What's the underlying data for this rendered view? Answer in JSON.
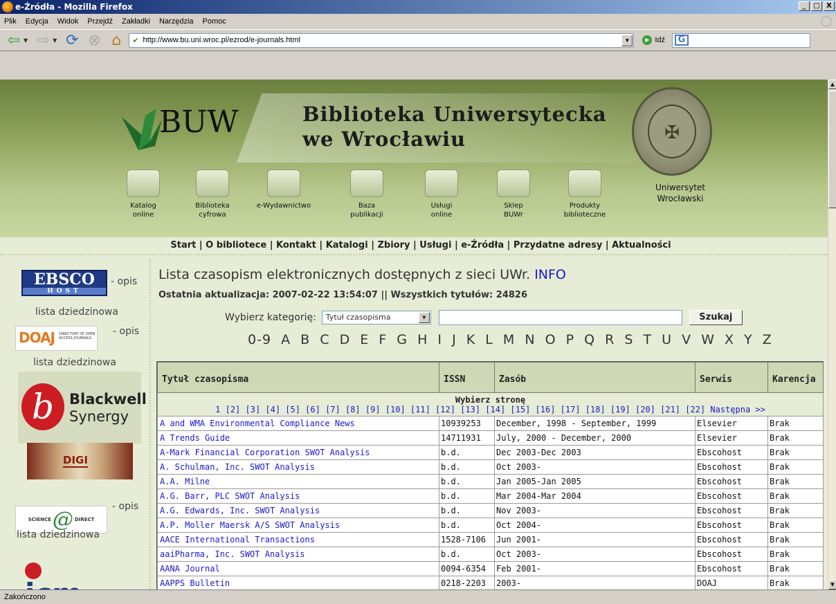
{
  "window": {
    "title": "e-Źródła - Mozilla Firefox",
    "buttons": [
      "_",
      "□",
      "X"
    ]
  },
  "menu": [
    "Plik",
    "Edycja",
    "Widok",
    "Przejdź",
    "Zakładki",
    "Narzędzia",
    "Pomoc"
  ],
  "toolbar": {
    "url": "http://www.bu.uni.wroc.pl/ezrod/e-journals.html",
    "go_label": "Idź",
    "search_engine_icon": "google-icon"
  },
  "banner": {
    "title_line1": "Biblioteka Uniwersytecka",
    "title_line2": "we Wrocławiu",
    "logo_text": "BUW",
    "university_line1": "Uniwersytet",
    "university_line2": "Wrocławski",
    "icons": [
      {
        "line1": "Katalog",
        "line2": "online"
      },
      {
        "line1": "Biblioteka",
        "line2": "cyfrowa"
      },
      {
        "line1": "e-Wydawnictwo",
        "line2": ""
      },
      {
        "line1": "Baza",
        "line2": "publikacji"
      },
      {
        "line1": "Usługi",
        "line2": "online"
      },
      {
        "line1": "Sklep",
        "line2": "BUWr"
      },
      {
        "line1": "Produkty",
        "line2": "biblioteczne"
      }
    ]
  },
  "topnav": "Start | O bibliotece | Kontakt | Katalogi | Zbiory | Usługi | e-Źródła | Przydatne adresy | Aktualności",
  "sidebar": {
    "ebsco_text": "EBSCO",
    "ebsco_sub": "HOST",
    "opis": "- opis",
    "lista": "lista dziedzinowa",
    "doaj_text": "DOAJ",
    "doaj_sub": "DIRECTORY OF OPEN ACCESS JOURNALS",
    "blackwell_1": "Blackwell",
    "blackwell_2": "Synergy",
    "blackwell_letter": "b",
    "digi_text": "DIGI",
    "sd_left": "SCIENCE",
    "sd_at": "@",
    "sd_right": "DIRECT",
    "icm_text": "icm"
  },
  "main": {
    "title": "Lista czasopism elektronicznych dostępnych z sieci UWr.",
    "info_link": "INFO",
    "updated": "Ostatnia aktualizacja: 2007-02-22 13:54:07 || Wszystkich tytułów: 24826",
    "category_label": "Wybierz kategorię:",
    "category_value": "Tytuł czasopisma",
    "search_button": "Szukaj",
    "alphabet": [
      "0-9",
      "A",
      "B",
      "C",
      "D",
      "E",
      "F",
      "G",
      "H",
      "I",
      "J",
      "K",
      "L",
      "M",
      "N",
      "O",
      "P",
      "Q",
      "R",
      "S",
      "T",
      "U",
      "V",
      "W",
      "X",
      "Y",
      "Z"
    ]
  },
  "table": {
    "headers": [
      "Tytuł czasopisma",
      "ISSN",
      "Zasób",
      "Serwis",
      "Karencja"
    ],
    "pages_title": "Wybierz stronę",
    "pages": "1 [2] [3] [4] [5] [6] [7] [8] [9] [10] [11] [12] [13] [14] [15] [16] [17] [18] [19] [20] [21] [22] Następna >>",
    "rows": [
      [
        "A and WMA Environmental Compliance News",
        "10939253",
        "December, 1998 - September, 1999",
        "Elsevier",
        "Brak"
      ],
      [
        "A Trends Guide",
        "14711931",
        "July, 2000 - December, 2000",
        "Elsevier",
        "Brak"
      ],
      [
        "A-Mark Financial Corporation SWOT Analysis",
        "b.d.",
        "Dec 2003-Dec 2003",
        "Ebscohost",
        "Brak"
      ],
      [
        "A. Schulman, Inc. SWOT Analysis",
        "b.d.",
        "Oct 2003-",
        "Ebscohost",
        "Brak"
      ],
      [
        "A.A. Milne",
        "b.d.",
        "Jan 2005-Jan 2005",
        "Ebscohost",
        "Brak"
      ],
      [
        "A.G. Barr, PLC SWOT Analysis",
        "b.d.",
        "Mar 2004-Mar 2004",
        "Ebscohost",
        "Brak"
      ],
      [
        "A.G. Edwards, Inc. SWOT Analysis",
        "b.d.",
        "Nov 2003-",
        "Ebscohost",
        "Brak"
      ],
      [
        "A.P. Moller Maersk A/S SWOT Analysis",
        "b.d.",
        "Oct 2004-",
        "Ebscohost",
        "Brak"
      ],
      [
        "AACE International Transactions",
        "1528-7106",
        "Jun 2001-",
        "Ebscohost",
        "Brak"
      ],
      [
        "aaiPharma, Inc. SWOT Analysis",
        "b.d.",
        "Oct 2003-",
        "Ebscohost",
        "Brak"
      ],
      [
        "AANA Journal",
        "0094-6354",
        "Feb 2001-",
        "Ebscohost",
        "Brak"
      ],
      [
        "AAPPS Bulletin",
        "0218-2203",
        "2003-",
        "DOAJ",
        "Brak"
      ]
    ]
  },
  "status": "Zakończono"
}
